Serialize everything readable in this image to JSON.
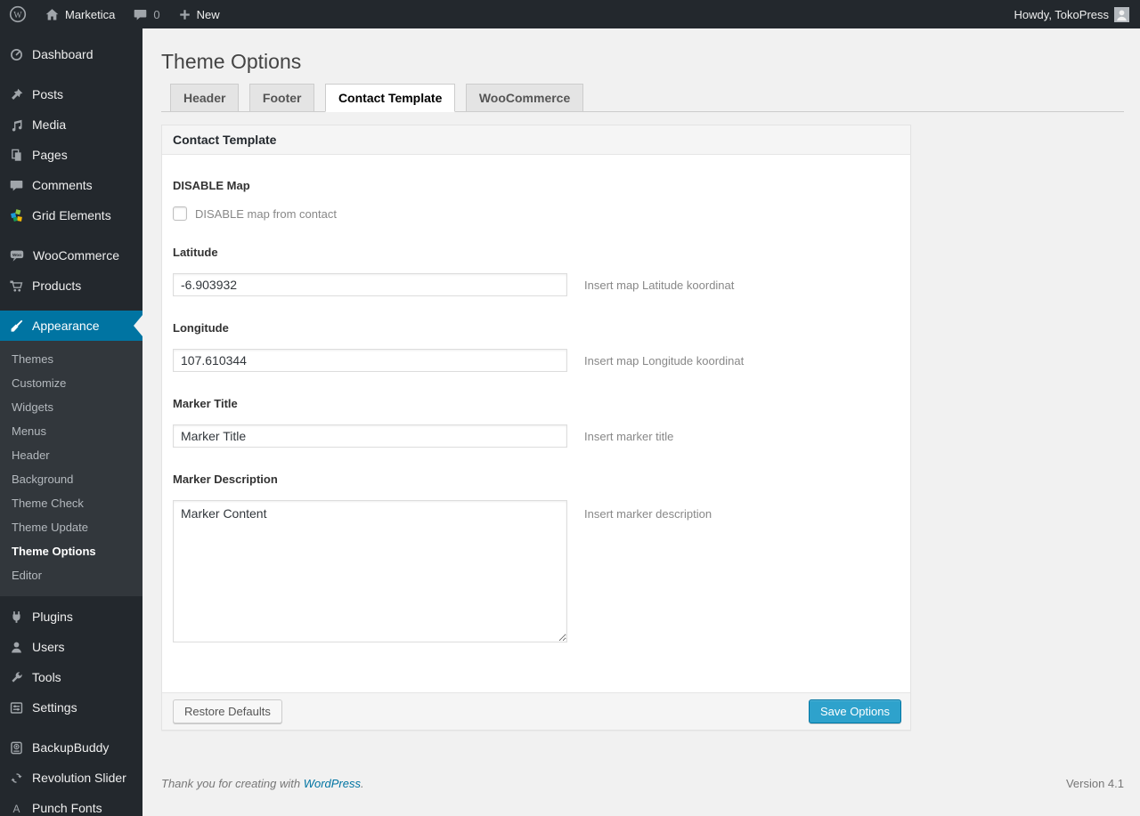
{
  "admin_bar": {
    "site_name": "Marketica",
    "comment_count": "0",
    "new_label": "New",
    "howdy": "Howdy, TokoPress"
  },
  "sidebar": {
    "items": [
      {
        "label": "Dashboard",
        "icon": "dashboard-icon"
      },
      {
        "label": "Posts",
        "icon": "pin-icon"
      },
      {
        "label": "Media",
        "icon": "media-icon"
      },
      {
        "label": "Pages",
        "icon": "pages-icon"
      },
      {
        "label": "Comments",
        "icon": "comments-icon"
      },
      {
        "label": "Grid Elements",
        "icon": "grid-elements-icon"
      },
      {
        "label": "WooCommerce",
        "icon": "woocommerce-icon"
      },
      {
        "label": "Products",
        "icon": "cart-icon"
      },
      {
        "label": "Appearance",
        "icon": "brush-icon",
        "current": true
      },
      {
        "label": "Plugins",
        "icon": "plugin-icon"
      },
      {
        "label": "Users",
        "icon": "user-icon"
      },
      {
        "label": "Tools",
        "icon": "wrench-icon"
      },
      {
        "label": "Settings",
        "icon": "settings-icon"
      },
      {
        "label": "BackupBuddy",
        "icon": "backup-icon"
      },
      {
        "label": "Revolution Slider",
        "icon": "cycle-icon"
      },
      {
        "label": "Punch Fonts",
        "icon": "font-icon"
      }
    ],
    "appearance_submenu": [
      {
        "label": "Themes"
      },
      {
        "label": "Customize"
      },
      {
        "label": "Widgets"
      },
      {
        "label": "Menus"
      },
      {
        "label": "Header"
      },
      {
        "label": "Background"
      },
      {
        "label": "Theme Check"
      },
      {
        "label": "Theme Update"
      },
      {
        "label": "Theme Options",
        "current": true
      },
      {
        "label": "Editor"
      }
    ]
  },
  "page": {
    "title": "Theme Options",
    "tabs": [
      {
        "label": "Header",
        "active": false
      },
      {
        "label": "Footer",
        "active": false
      },
      {
        "label": "Contact Template",
        "active": true
      },
      {
        "label": "WooCommerce",
        "active": false
      }
    ],
    "panel": {
      "header": "Contact Template",
      "fields": {
        "disable_map": {
          "label": "DISABLE Map",
          "checkbox_label": "DISABLE map from contact",
          "checked": false
        },
        "latitude": {
          "label": "Latitude",
          "value": "-6.903932",
          "hint": "Insert map Latitude koordinat"
        },
        "longitude": {
          "label": "Longitude",
          "value": "107.610344",
          "hint": "Insert map Longitude koordinat"
        },
        "marker_title": {
          "label": "Marker Title",
          "value": "Marker Title",
          "hint": "Insert marker title"
        },
        "marker_description": {
          "label": "Marker Description",
          "value": "Marker Content",
          "hint": "Insert marker description"
        }
      },
      "buttons": {
        "restore": "Restore Defaults",
        "save": "Save Options"
      }
    },
    "footer": {
      "thanks_prefix": "Thank you for creating with ",
      "link_text": "WordPress",
      "thanks_suffix": ".",
      "version": "Version 4.1"
    }
  },
  "colors": {
    "admin_bar_bg": "#23282d",
    "menu_bg": "#23282d",
    "submenu_bg": "#32373c",
    "accent_blue": "#0074a2",
    "primary_button_bg": "#2ea2cc",
    "page_bg": "#f1f1f1"
  }
}
